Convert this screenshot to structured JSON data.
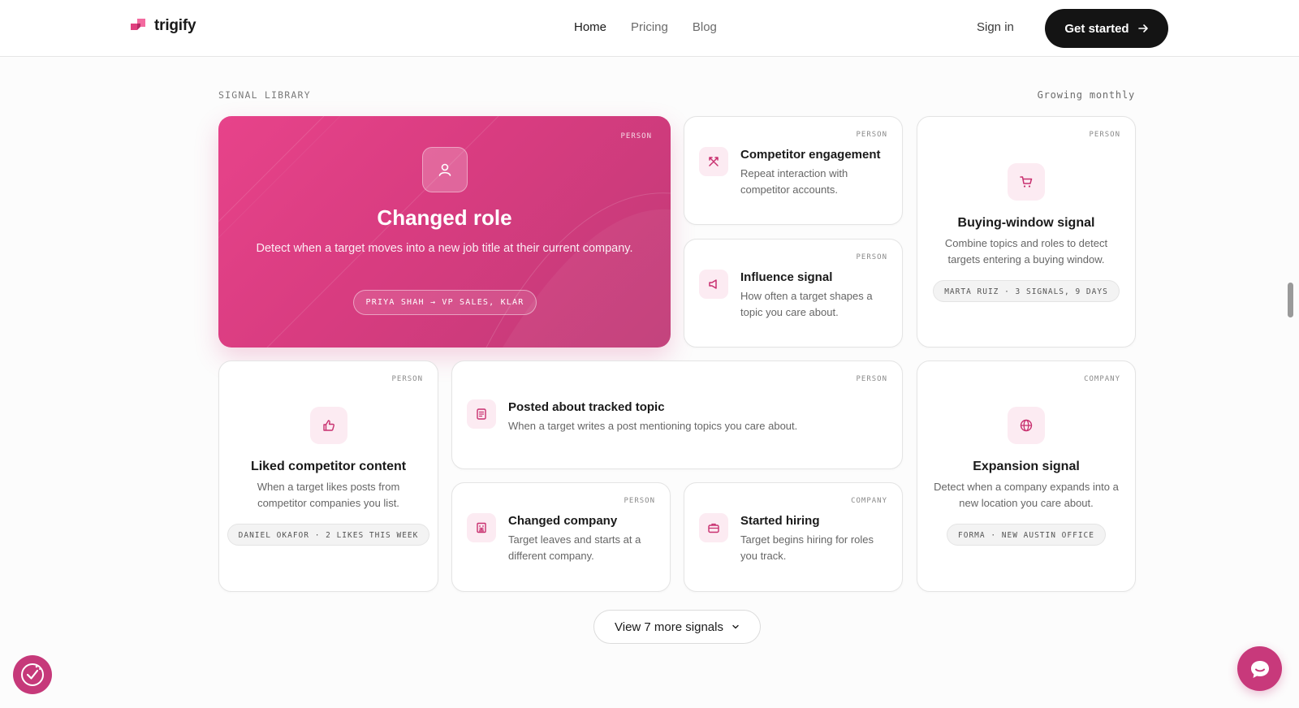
{
  "nav": {
    "logo_text": "trigify",
    "links": [
      "Home",
      "Pricing",
      "Blog"
    ],
    "sign_in": "Sign in",
    "cta": "Get started"
  },
  "section": {
    "label": "SIGNAL LIBRARY",
    "right_label": "Growing monthly"
  },
  "hero": {
    "tag": "PERSON",
    "title": "Changed role",
    "description": "Detect when a target moves into a new job title at their current company.",
    "example": "PRIYA SHAH → VP SALES, KLAR",
    "icon": "person-icon"
  },
  "cards": {
    "competitor": {
      "tag": "PERSON",
      "title": "Competitor engagement",
      "description": "Repeat interaction with competitor accounts.",
      "icon": "crossed-swords-icon"
    },
    "influence": {
      "tag": "PERSON",
      "title": "Influence signal",
      "description": "How often a target shapes a topic you care about.",
      "icon": "megaphone-icon"
    },
    "buying": {
      "tag": "PERSON",
      "title": "Buying-window signal",
      "description": "Combine topics and roles to detect targets entering a buying window.",
      "example": "MARTA RUIZ · 3 SIGNALS, 9 DAYS",
      "icon": "cart-icon"
    },
    "liked": {
      "tag": "PERSON",
      "title": "Liked competitor content",
      "description": "When a target likes posts from competitor companies you list.",
      "example": "DANIEL OKAFOR · 2 LIKES THIS WEEK",
      "icon": "thumbs-up-icon"
    },
    "posted": {
      "tag": "PERSON",
      "title": "Posted about tracked topic",
      "description": "When a target writes a post mentioning topics you care about.",
      "icon": "document-icon"
    },
    "expansion": {
      "tag": "COMPANY",
      "title": "Expansion signal",
      "description": "Detect when a company expands into a new location you care about.",
      "example": "FORMA · NEW AUSTIN OFFICE",
      "icon": "globe-icon"
    },
    "changed_company": {
      "tag": "PERSON",
      "title": "Changed company",
      "description": "Target leaves and starts at a different company.",
      "icon": "building-icon"
    },
    "hiring": {
      "tag": "COMPANY",
      "title": "Started hiring",
      "description": "Target begins hiring for roles you track.",
      "icon": "briefcase-icon"
    }
  },
  "view_more": "View 7 more signals",
  "colors": {
    "accent": "#d83c80",
    "icon_bg": "#fcebf2",
    "dark": "#141414"
  }
}
